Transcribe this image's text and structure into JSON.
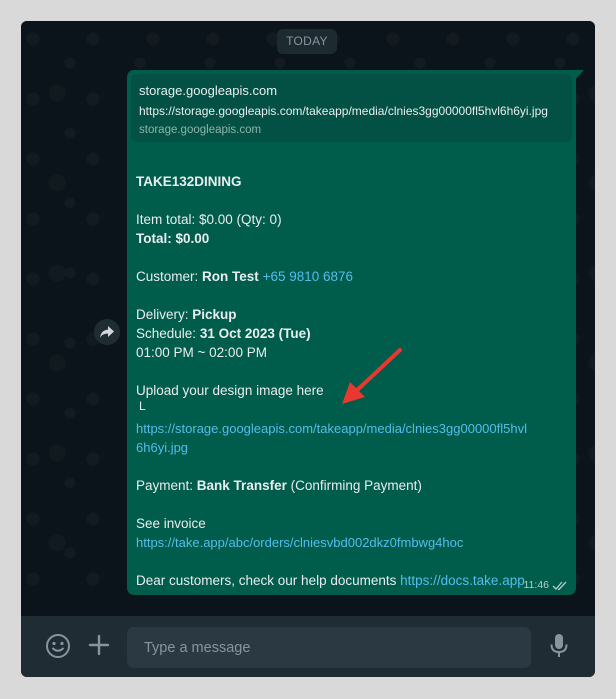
{
  "date_chip": "TODAY",
  "message": {
    "preview": {
      "title": "storage.googleapis.com",
      "url": "https://storage.googleapis.com/takeapp/media/clnies3gg00000fl5hvl6h6yi.jpg",
      "domain": "storage.googleapis.com"
    },
    "store_name": "TAKE132DINING",
    "item_total": "Item total: $0.00 (Qty: 0)",
    "total_label": "Total: $0.00",
    "customer_label": "Customer:",
    "customer_name": "Ron Test",
    "customer_phone": "+65 9810 6876",
    "delivery_label": "Delivery:",
    "delivery_value": "Pickup",
    "schedule_label": "Schedule:",
    "schedule_value": "31 Oct 2023 (Tue)",
    "time_range": "01:00 PM ~ 02:00 PM",
    "upload_text": "Upload your design image here",
    "upload_marker": "L",
    "upload_link_line1": "https://storage.googleapis.com/takeapp/media/clnies3gg00000fl5hvl",
    "upload_link_line2": "6h6yi.jpg",
    "payment_label": "Payment:",
    "payment_method": "Bank Transfer",
    "payment_status": "(Confirming Payment)",
    "invoice_text": "See invoice",
    "invoice_link": "https://take.app/abc/orders/clniesvbd002dkz0fmbwg4hoc",
    "help_text": "Dear customers, check our help documents",
    "help_link": "https://docs.take.app",
    "time": "11:46"
  },
  "compose": {
    "placeholder": "Type a message"
  },
  "icons": {
    "forward": "forward-icon",
    "emoji": "emoji-icon",
    "attach": "plus-icon",
    "mic": "microphone-icon",
    "read_receipt": "double-check-icon",
    "annotation": "red-arrow-icon"
  },
  "colors": {
    "bubble": "#005c4b",
    "link": "#53bdeb",
    "background": "#0b141a",
    "arrow": "#e8382f"
  }
}
